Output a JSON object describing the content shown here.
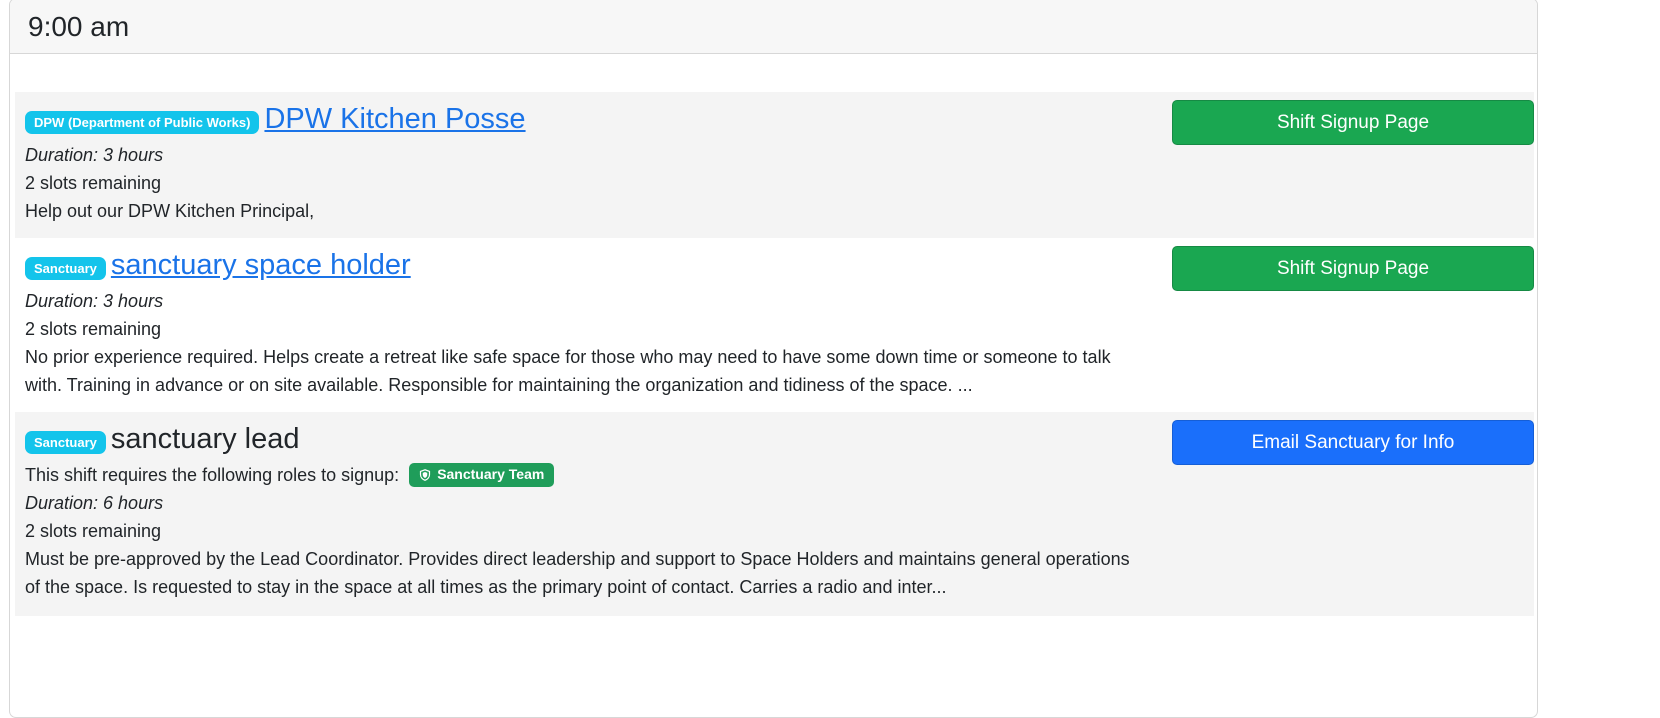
{
  "header": {
    "time": "9:00 am"
  },
  "shifts": [
    {
      "badge": "DPW (Department of Public Works)",
      "title": "DPW Kitchen Posse",
      "duration": "Duration: 3 hours",
      "slots": "2 slots remaining",
      "description": "Help out our DPW Kitchen Principal,",
      "button": "Shift Signup Page"
    },
    {
      "badge": "Sanctuary",
      "title": "sanctuary space holder",
      "duration": "Duration: 3 hours",
      "slots": "2 slots remaining",
      "description": "No prior experience required. Helps create a retreat like safe space for those who may need to have some down time or someone to talk with. Training in advance or on site available. Responsible for maintaining the organization and tidiness of the space. ...",
      "button": "Shift Signup Page"
    },
    {
      "badge": "Sanctuary",
      "title": "sanctuary lead",
      "roles_text": "This shift requires the following roles to signup:",
      "role_badge": "Sanctuary Team",
      "duration": "Duration: 6 hours",
      "slots": "2 slots remaining",
      "description": "Must be pre-approved by the Lead Coordinator. Provides direct leadership and support to Space Holders and maintains general operations of the space. Is requested to stay in the space at all times as the primary point of contact. Carries a radio and inter...",
      "button": "Email Sanctuary for Info"
    }
  ],
  "icons": {
    "role_badge_icon": "shield-icon"
  },
  "colors": {
    "info_badge": "#13c4eb",
    "link": "#1a73e8",
    "success_button": "#1aa751",
    "primary_button": "#1a6ffb",
    "role_badge": "#1f9d5a",
    "alt_row": "#f4f4f4"
  }
}
